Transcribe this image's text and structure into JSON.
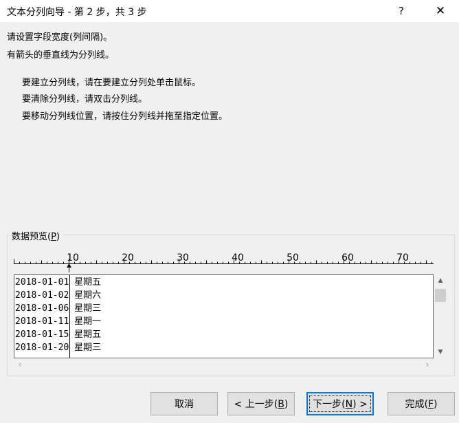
{
  "window": {
    "title": "文本分列向导 - 第 2 步，共 3 步",
    "help_glyph": "?",
    "close_glyph": "✕"
  },
  "instructions": {
    "line1": "请设置字段宽度(列间隔)。",
    "line2": "有箭头的垂直线为分列线。",
    "tips": [
      "要建立分列线，请在要建立分列处单击鼠标。",
      "要清除分列线，请双击分列线。",
      "要移动分列线位置，请按住分列线并拖至指定位置。"
    ]
  },
  "preview": {
    "label": "数据预览(",
    "label_key": "P",
    "label_end": ")",
    "ruler_ticks": [
      "10",
      "20",
      "30",
      "40",
      "50",
      "60",
      "70"
    ],
    "rows": [
      {
        "date": "2018-01-01",
        "day": "星期五"
      },
      {
        "date": "2018-01-02",
        "day": "星期六"
      },
      {
        "date": "2018-01-06",
        "day": "星期三"
      },
      {
        "date": "2018-01-11",
        "day": "星期一"
      },
      {
        "date": "2018-01-15",
        "day": "星期五"
      },
      {
        "date": "2018-01-20",
        "day": "星期三"
      }
    ]
  },
  "buttons": {
    "cancel": "取消",
    "back": "< 上一步(",
    "back_key": "B",
    "back_end": ")",
    "next": "下一步(",
    "next_key": "N",
    "next_end": ") >",
    "finish": "完成(",
    "finish_key": "F",
    "finish_end": ")"
  },
  "icons": {
    "scroll_up": "scroll-up-icon",
    "scroll_down": "scroll-down-icon",
    "scroll_left": "scroll-left-icon",
    "scroll_right": "scroll-right-icon"
  },
  "colors": {
    "background": "#f0f0f0",
    "default_button_border": "#0078d7",
    "button_face": "#e1e1e1"
  }
}
